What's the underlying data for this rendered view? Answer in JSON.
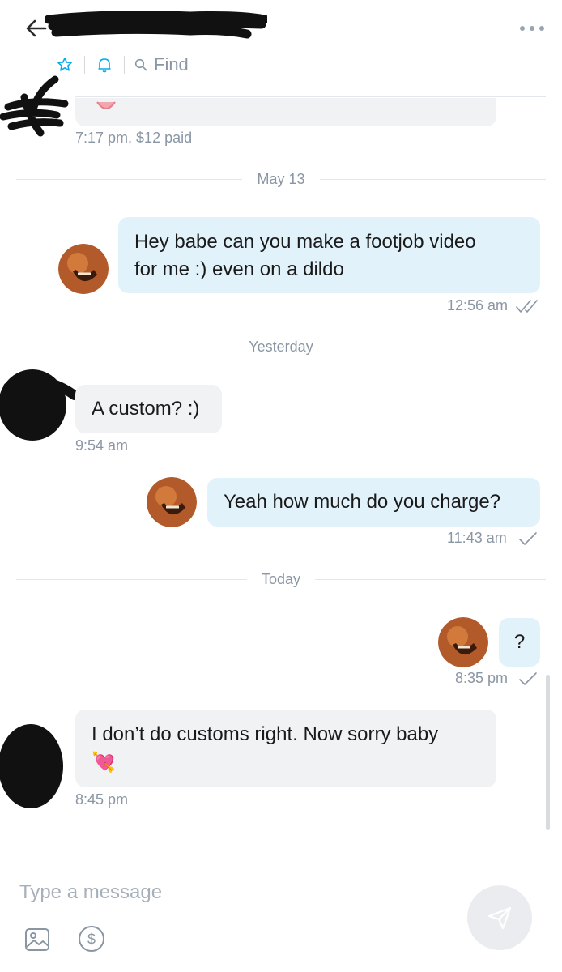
{
  "header": {
    "find_label": "Find"
  },
  "composer": {
    "placeholder": "Type a message"
  },
  "messages": [
    {
      "time": "7:17 pm, $12 paid"
    },
    {
      "date": "May 13"
    },
    {
      "line1": "Hey babe can you make a footjob video",
      "line2": "for me :) even on a dildo",
      "time": "12:56 am"
    },
    {
      "date": "Yesterday"
    },
    {
      "text": "A custom? :)",
      "time": "9:54 am"
    },
    {
      "text": "Yeah how much do you charge?",
      "time": "11:43 am"
    },
    {
      "date": "Today"
    },
    {
      "text": "?",
      "time": "8:35 pm"
    },
    {
      "text": "I don’t do customs right. Now sorry baby",
      "emoji": "💘",
      "time": "8:45 pm"
    }
  ],
  "colors": {
    "accent": "#00aeef",
    "sent_bubble": "#e2f2fb",
    "received_bubble": "#f1f2f4",
    "muted_text": "#8a96a3"
  }
}
